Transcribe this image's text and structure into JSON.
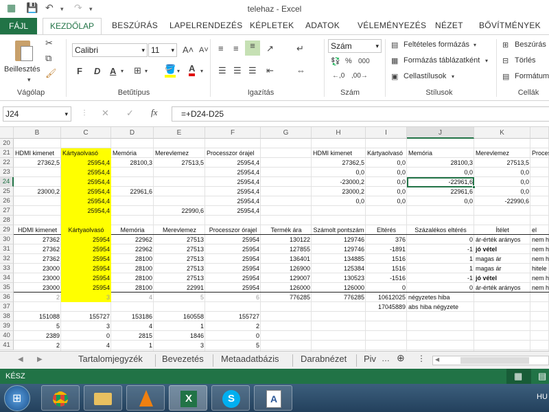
{
  "window": {
    "title": "telehaz - Excel"
  },
  "tabs": [
    "FÁJL",
    "KEZDŐLAP",
    "BESZÚRÁS",
    "LAPELRENDEZÉS",
    "KÉPLETEK",
    "ADATOK",
    "VÉLEMÉNYEZÉS",
    "NÉZET",
    "BŐVÍTMÉNYEK"
  ],
  "ribbon": {
    "paste_label": "Beillesztés",
    "clipboard_group": "Vágólap",
    "font_name": "Calibri",
    "font_size": "11",
    "font_group": "Betűtípus",
    "bold": "F",
    "italic": "D",
    "underline": "A",
    "align_group": "Igazítás",
    "number_format": "Szám",
    "number_group": "Szám",
    "cond_format": "Feltételes formázás",
    "table_format": "Formázás táblázatként",
    "cell_styles": "Cellastílusok",
    "styles_group": "Stílusok",
    "insert": "Beszúrás",
    "delete": "Törlés",
    "format": "Formátum",
    "cells_group": "Cellák",
    "pct": "%",
    "thousands": "000"
  },
  "formula_bar": {
    "name_box": "J24",
    "formula": "=+D24-D25",
    "fx": "fx"
  },
  "columns": [
    "B",
    "C",
    "D",
    "E",
    "F",
    "G",
    "H",
    "I",
    "J",
    "K"
  ],
  "rows": [
    "20",
    "21",
    "22",
    "23",
    "24",
    "25",
    "26",
    "27",
    "28",
    "29",
    "30",
    "31",
    "32",
    "33",
    "34",
    "35",
    "36",
    "37",
    "38",
    "39",
    "40",
    "41"
  ],
  "cells": {
    "r21": [
      "HDMI kimenet",
      "Kártyaolvasó",
      "Memória",
      "Merevlemez",
      "Processzor órajel",
      "",
      "HDMI kimenet",
      "Kártyaolvasó",
      "Memória",
      "Merevlemez",
      "Proces"
    ],
    "r22": [
      "27362,5",
      "25954,4",
      "28100,3",
      "27513,5",
      "25954,4",
      "",
      "27362,5",
      "0,0",
      "28100,3",
      "27513,5"
    ],
    "r23": [
      "",
      "25954,4",
      "",
      "",
      "25954,4",
      "",
      "0,0",
      "0,0",
      "0,0",
      "0,0"
    ],
    "r24": [
      "",
      "25954,4",
      "",
      "",
      "25954,4",
      "",
      "-23000,2",
      "0,0",
      "-22961,6",
      "0,0"
    ],
    "r25": [
      "23000,2",
      "25954,4",
      "22961,6",
      "",
      "25954,4",
      "",
      "23000,2",
      "0,0",
      "22961,6",
      "0,0"
    ],
    "r26": [
      "",
      "25954,4",
      "",
      "",
      "25954,4",
      "",
      "0,0",
      "0,0",
      "0,0",
      "-22990,6"
    ],
    "r27": [
      "",
      "25954,4",
      "",
      "22990,6",
      "25954,4"
    ],
    "r29": [
      "HDMI kimenet",
      "Kártyaolvasó",
      "Memória",
      "Merevlemez",
      "Processzor órajel",
      "Termék ára",
      "Számolt pontszám",
      "Eltérés",
      "Százalékos eltérés",
      "Ítélet",
      "el"
    ],
    "r30": [
      "27362",
      "25954",
      "22962",
      "27513",
      "25954",
      "130122",
      "129746",
      "376",
      "0",
      "ár-érték arányos",
      "nem h"
    ],
    "r31": [
      "27362",
      "25954",
      "22962",
      "27513",
      "25954",
      "127855",
      "129746",
      "-1891",
      "-1",
      "jó vétel",
      "nem h"
    ],
    "r32": [
      "27362",
      "25954",
      "28100",
      "27513",
      "25954",
      "136401",
      "134885",
      "1516",
      "1",
      "magas ár",
      "nem h"
    ],
    "r33": [
      "23000",
      "25954",
      "28100",
      "27513",
      "25954",
      "126900",
      "125384",
      "1516",
      "1",
      "magas ár",
      "hitele"
    ],
    "r34": [
      "23000",
      "25954",
      "28100",
      "27513",
      "25954",
      "129007",
      "130523",
      "-1516",
      "-1",
      "jó vétel",
      "nem h"
    ],
    "r35": [
      "23000",
      "25954",
      "28100",
      "22991",
      "25954",
      "126000",
      "126000",
      "0",
      "0",
      "ár-érték arányos",
      "nem h"
    ],
    "r36": [
      "2",
      "3",
      "4",
      "5",
      "6",
      "776285",
      "776285",
      "10612025",
      "négyzetes hiba"
    ],
    "r37": [
      "",
      "",
      "",
      "",
      "",
      "",
      "",
      "17045889",
      "abs hiba négyzete"
    ],
    "r38": [
      "151088",
      "155727",
      "153186",
      "160558",
      "155727"
    ],
    "r39": [
      "5",
      "3",
      "4",
      "1",
      "2"
    ],
    "r40": [
      "2389",
      "0",
      "2815",
      "1846",
      "0"
    ],
    "r41": [
      "2",
      "4",
      "1",
      "3",
      "5"
    ]
  },
  "sheets": [
    "Tartalomjegyzék",
    "Bevezetés",
    "Metaadatbázis",
    "Darabnézet",
    "Piv"
  ],
  "status": {
    "mode": "KÉSZ"
  },
  "taskbar": {
    "lang": "HU"
  },
  "colors": {
    "excel_green": "#217346",
    "highlight": "#ffff00"
  }
}
